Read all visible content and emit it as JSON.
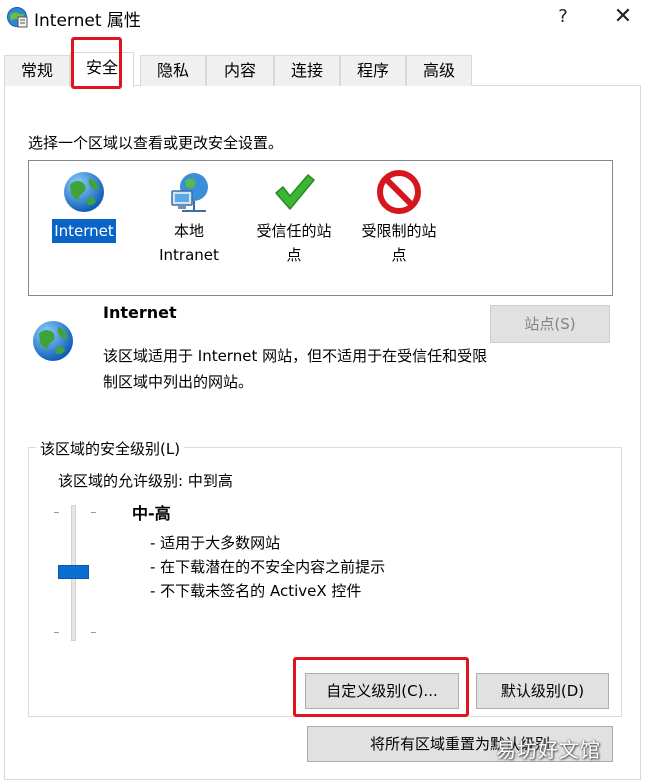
{
  "window": {
    "title": "Internet 属性",
    "help_glyph": "?",
    "close_glyph": "✕"
  },
  "tabs": [
    {
      "label": "常规"
    },
    {
      "label": "安全"
    },
    {
      "label": "隐私"
    },
    {
      "label": "内容"
    },
    {
      "label": "连接"
    },
    {
      "label": "程序"
    },
    {
      "label": "高级"
    }
  ],
  "active_tab": "安全",
  "security": {
    "instruction": "选择一个区域以查看或更改安全设置。",
    "zones": [
      {
        "label": "Internet",
        "icon": "globe-icon",
        "selected": true
      },
      {
        "label": "本地\nIntranet",
        "icon": "network-globe-icon",
        "selected": false
      },
      {
        "label": "受信任的站\n点",
        "icon": "check-icon",
        "selected": false
      },
      {
        "label": "受限制的站\n点",
        "icon": "no-entry-icon",
        "selected": false
      }
    ],
    "selected_zone": {
      "title": "Internet",
      "description": "该区域适用于 Internet 网站，但不适用于在受信任和受限制区域中列出的网站。",
      "sites_button": "站点(S)"
    },
    "level_group": {
      "label": "该区域的安全级别(L)",
      "allowed": "该区域的允许级别: 中到高",
      "level_name": "中-高",
      "bullets": [
        "- 适用于大多数网站",
        "- 在下载潜在的不安全内容之前提示",
        "- 不下载未签名的 ActiveX 控件"
      ],
      "custom_button": "自定义级别(C)...",
      "default_button": "默认级别(D)"
    },
    "reset_button": "将所有区域重置为默认级别"
  },
  "watermark": "易坊好文馆",
  "colors": {
    "highlight_box": "#e0141e",
    "selection": "#0a64c8",
    "slider_thumb": "#0a6fd1"
  }
}
